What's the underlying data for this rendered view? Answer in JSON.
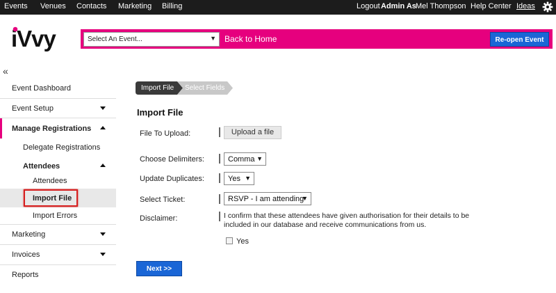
{
  "topnav": {
    "left_links": [
      "Events",
      "Venues",
      "Contacts",
      "Marketing",
      "Billing"
    ],
    "logout_label": "Logout",
    "admin_as_label": "Admin As",
    "user_name": "Mel Thompson",
    "help_center": "Help Center",
    "ideas": "Ideas"
  },
  "header": {
    "logo_text": "iVvy",
    "select_event_placeholder": "Select An Event...",
    "back_home": "Back to Home",
    "reopen_button": "Re-open Event",
    "brand_color": "#e6007e",
    "button_color": "#1a66d6"
  },
  "sidebar": {
    "collapse_glyph": "«",
    "event_dashboard": "Event Dashboard",
    "event_setup": "Event Setup",
    "manage_registrations": "Manage Registrations",
    "delegate_registrations": "Delegate Registrations",
    "attendees_group": "Attendees",
    "attendees": "Attendees",
    "import_file": "Import File",
    "import_errors": "Import Errors",
    "marketing": "Marketing",
    "invoices": "Invoices",
    "reports": "Reports"
  },
  "wizard": {
    "step1": "Import File",
    "step2": "Select Fields"
  },
  "form": {
    "title": "Import File",
    "file_label": "File To Upload:",
    "upload_button": "Upload a file",
    "delimiters_label": "Choose Delimiters:",
    "delimiters_value": "Comma",
    "duplicates_label": "Update Duplicates:",
    "duplicates_value": "Yes",
    "ticket_label": "Select Ticket:",
    "ticket_value": "RSVP - I am attending",
    "disclaimer_label": "Disclaimer:",
    "disclaimer_text": "I confirm that these attendees have given authorisation for their details to be included in our database and receive communications from us.",
    "checkbox_label": "Yes",
    "next_button": "Next >>"
  }
}
